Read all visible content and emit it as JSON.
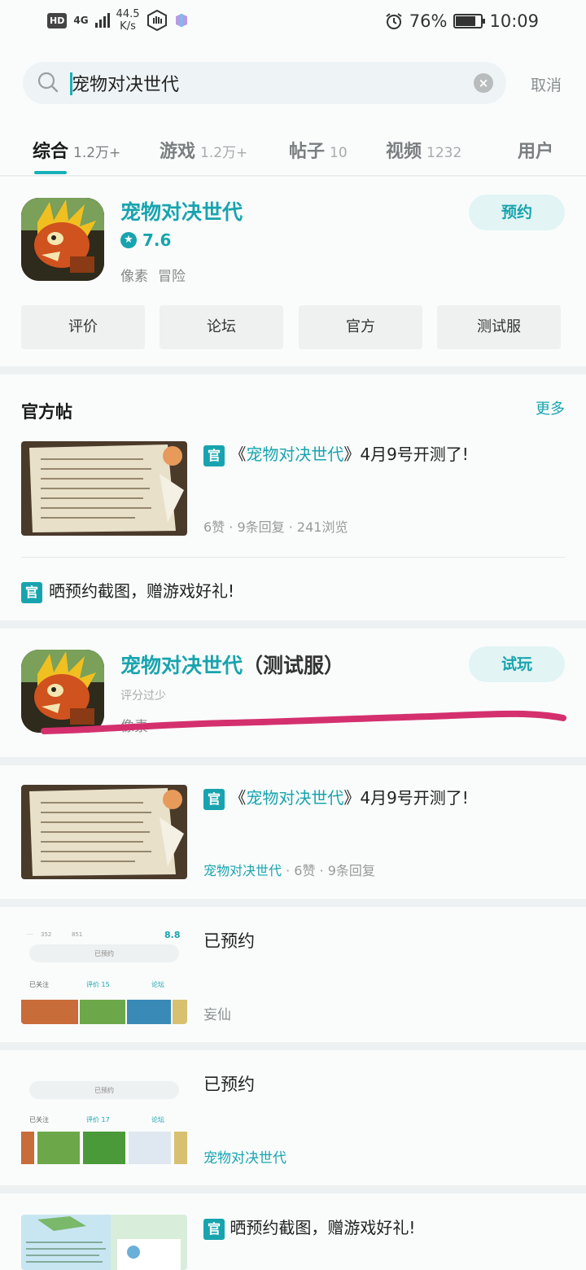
{
  "status_bar": {
    "hd": "HD",
    "network": "4G",
    "speed_value": "44.5",
    "speed_unit": "K/s",
    "battery": "76%",
    "time": "10:09"
  },
  "search": {
    "query": "宠物对决世代",
    "cancel_label": "取消"
  },
  "tabs": [
    {
      "label": "综合",
      "count": "1.2万+",
      "active": true
    },
    {
      "label": "游戏",
      "count": "1.2万+"
    },
    {
      "label": "帖子",
      "count": "10"
    },
    {
      "label": "视频",
      "count": "1232"
    },
    {
      "label": "用户",
      "count": ""
    }
  ],
  "game_card": {
    "name": "宠物对决世代",
    "rating": "7.6",
    "tags": [
      "像素",
      "冒险"
    ],
    "action_label": "预约",
    "quick_links": [
      "评价",
      "论坛",
      "官方",
      "测试服"
    ]
  },
  "official_posts": {
    "title": "官方帖",
    "more_label": "更多",
    "badge": "官",
    "post1": {
      "title_prefix": "《",
      "title_game": "宠物对决世代",
      "title_suffix": "》4月9号开测了!",
      "likes": "6赞",
      "replies": "9条回复",
      "views": "241浏览"
    },
    "notice": "晒预约截图，赠游戏好礼!"
  },
  "test_server_card": {
    "name": "宠物对决世代",
    "name_suffix": "（测试服）",
    "score_note": "评分过少",
    "tag": "像素",
    "action_label": "试玩"
  },
  "post2": {
    "badge": "官",
    "title_prefix": "《",
    "title_game": "宠物对决世代",
    "title_suffix": "》4月9号开测了!",
    "game": "宠物对决世代",
    "likes": "6赞",
    "replies": "9条回复"
  },
  "post3": {
    "title": "已预约",
    "author": "妄仙",
    "thumb": {
      "score": "8.8",
      "stat1": "352",
      "stat2": "851",
      "status": "已预约",
      "follow": "已关注",
      "review": "评价 15",
      "forum": "论坛"
    }
  },
  "post4": {
    "title": "已预约",
    "game": "宠物对决世代",
    "thumb": {
      "status": "已预约",
      "follow": "已关注",
      "review": "评价 17",
      "forum": "论坛"
    }
  },
  "post5": {
    "badge": "官",
    "title": "晒预约截图，赠游戏好礼!"
  },
  "colors": {
    "accent": "#18a4ae",
    "underline_mark": "#d4306e",
    "background": "#eef1f1"
  },
  "icons": [
    "search-icon",
    "clear-icon",
    "star-icon",
    "alarm-icon",
    "battery-icon",
    "signal-icon"
  ]
}
